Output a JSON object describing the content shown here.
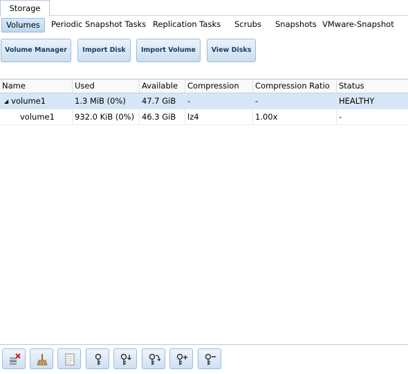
{
  "top_tab": {
    "label": "Storage"
  },
  "subtabs": [
    {
      "label": "Volumes",
      "active": true
    },
    {
      "label": "Periodic Snapshot Tasks"
    },
    {
      "label": "Replication Tasks"
    },
    {
      "label": "Scrubs"
    },
    {
      "label": "Snapshots"
    },
    {
      "label": "VMware-Snapshot"
    }
  ],
  "actions": {
    "volume_manager": "Volume Manager",
    "import_disk": "Import Disk",
    "import_volume": "Import Volume",
    "view_disks": "View Disks"
  },
  "table": {
    "headers": {
      "name": "Name",
      "used": "Used",
      "available": "Available",
      "compression": "Compression",
      "ratio": "Compression Ratio",
      "status": "Status"
    },
    "rows": [
      {
        "name": "volume1",
        "used": "1.3 MiB (0%)",
        "available": "47.7 GiB",
        "compression": "-",
        "ratio": "-",
        "status": "HEALTHY"
      },
      {
        "name": "volume1",
        "used": "932.0 KiB (0%)",
        "available": "46.3 GiB",
        "compression": "lz4",
        "ratio": "1.00x",
        "status": "-"
      }
    ]
  },
  "toolbar": {
    "icons": [
      "detach-volume-icon",
      "scrub-volume-icon",
      "volume-status-icon",
      "encryption-key-icon",
      "download-key-icon",
      "change-passphrase-icon",
      "add-recovery-key-icon",
      "remove-recovery-key-icon"
    ]
  },
  "colors": {
    "accent": "#bcd7ef",
    "border": "#9fbad3",
    "selected_row": "#d6e6f6"
  }
}
